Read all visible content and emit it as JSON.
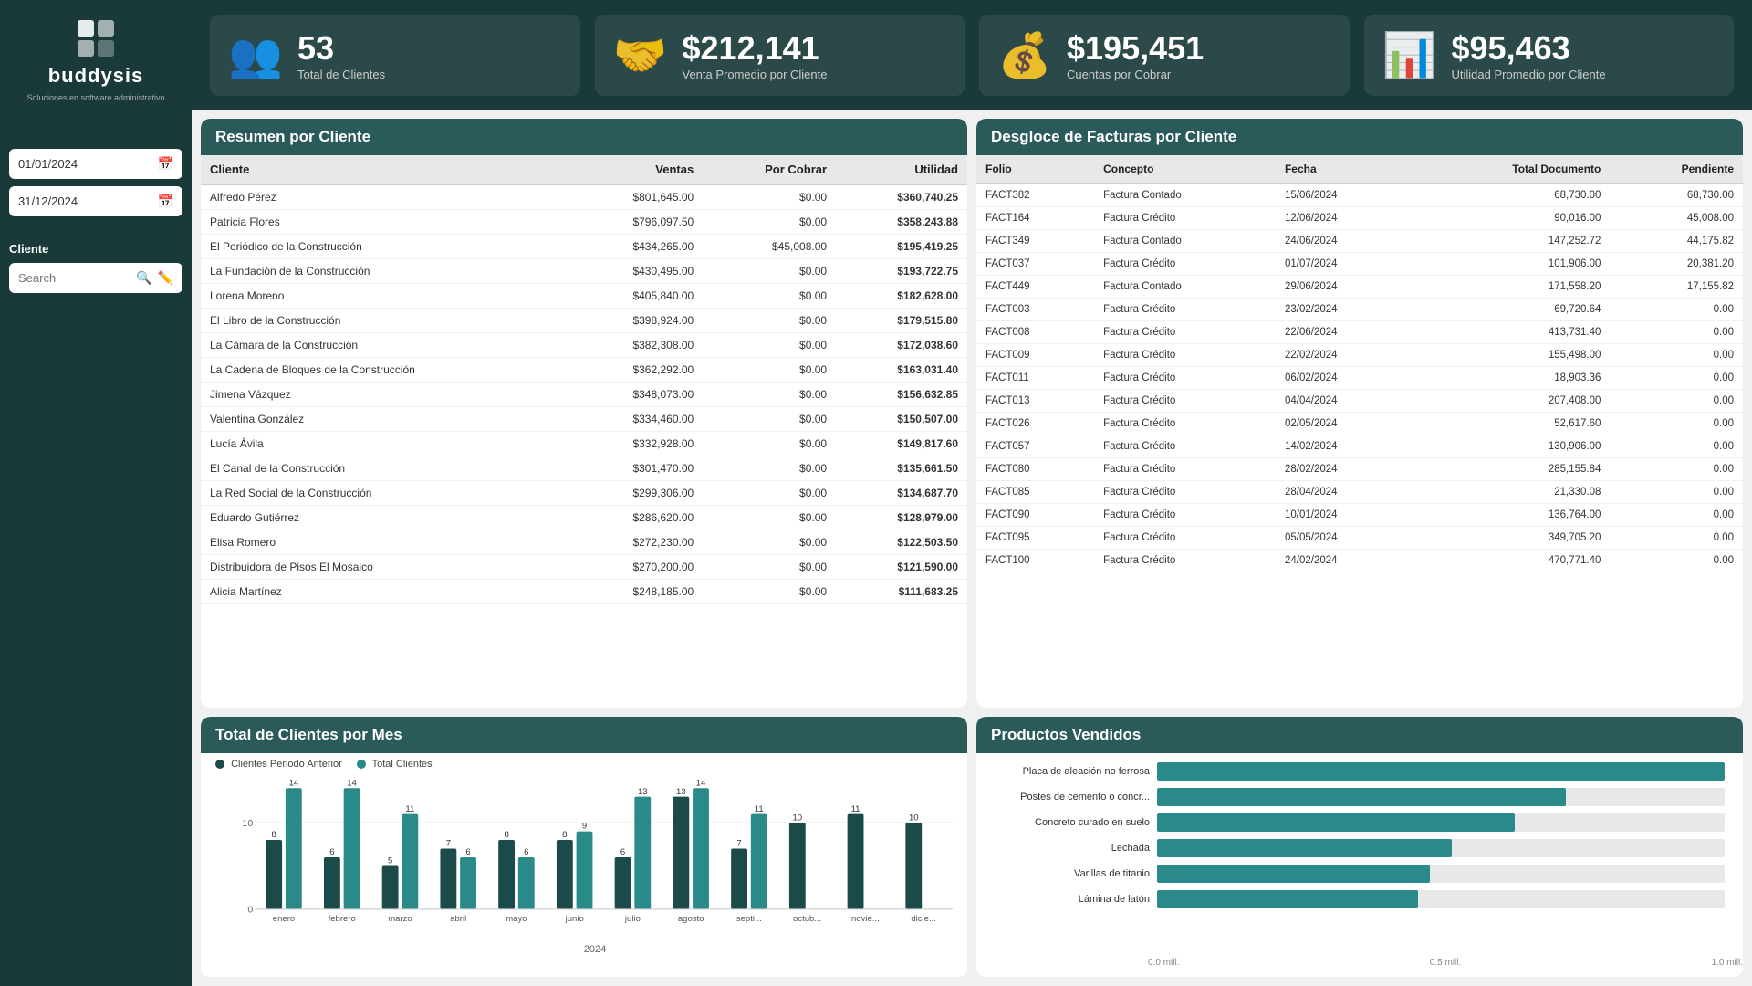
{
  "logo": {
    "text": "buddysis",
    "sub": "Soluciones en software administrativo"
  },
  "dates": {
    "start": "01/01/2024",
    "end": "31/12/2024"
  },
  "filter": {
    "label": "Cliente",
    "search_placeholder": "Search"
  },
  "stats": [
    {
      "value": "53",
      "label": "Total de Clientes",
      "icon": "👥"
    },
    {
      "value": "$212,141",
      "label": "Venta Promedio por Cliente",
      "icon": "🤝"
    },
    {
      "value": "$195,451",
      "label": "Cuentas por Cobrar",
      "icon": "💰"
    },
    {
      "value": "$95,463",
      "label": "Utilidad Promedio por Cliente",
      "icon": "📊"
    }
  ],
  "resumen": {
    "title": "Resumen por Cliente",
    "columns": [
      "Cliente",
      "Ventas",
      "Por Cobrar",
      "Utilidad"
    ],
    "rows": [
      [
        "Alfredo Pérez",
        "$801,645.00",
        "$0.00",
        "$360,740.25"
      ],
      [
        "Patricia Flores",
        "$796,097.50",
        "$0.00",
        "$358,243.88"
      ],
      [
        "El Periódico de la Construcción",
        "$434,265.00",
        "$45,008.00",
        "$195,419.25"
      ],
      [
        "La Fundación de la Construcción",
        "$430,495.00",
        "$0.00",
        "$193,722.75"
      ],
      [
        "Lorena Moreno",
        "$405,840.00",
        "$0.00",
        "$182,628.00"
      ],
      [
        "El Libro de la Construcción",
        "$398,924.00",
        "$0.00",
        "$179,515.80"
      ],
      [
        "La Cámara de la Construcción",
        "$382,308.00",
        "$0.00",
        "$172,038.60"
      ],
      [
        "La Cadena de Bloques de la Construcción",
        "$362,292.00",
        "$0.00",
        "$163,031.40"
      ],
      [
        "Jimena Vázquez",
        "$348,073.00",
        "$0.00",
        "$156,632.85"
      ],
      [
        "Valentina González",
        "$334,460.00",
        "$0.00",
        "$150,507.00"
      ],
      [
        "Lucía Ávila",
        "$332,928.00",
        "$0.00",
        "$149,817.60"
      ],
      [
        "El Canal de la Construcción",
        "$301,470.00",
        "$0.00",
        "$135,661.50"
      ],
      [
        "La Red Social de la Construcción",
        "$299,306.00",
        "$0.00",
        "$134,687.70"
      ],
      [
        "Eduardo Gutiérrez",
        "$286,620.00",
        "$0.00",
        "$128,979.00"
      ],
      [
        "Elisa Romero",
        "$272,230.00",
        "$0.00",
        "$122,503.50"
      ],
      [
        "Distribuidora de Pisos El Mosaico",
        "$270,200.00",
        "$0.00",
        "$121,590.00"
      ],
      [
        "Alicia Martínez",
        "$248,185.00",
        "$0.00",
        "$111,683.25"
      ]
    ]
  },
  "facturas": {
    "title": "Desgloce de Facturas por Cliente",
    "columns": [
      "Folio",
      "Concepto",
      "Fecha",
      "Total Documento",
      "Pendiente"
    ],
    "rows": [
      [
        "FACT382",
        "Factura Contado",
        "15/06/2024",
        "68,730.00",
        "68,730.00"
      ],
      [
        "FACT164",
        "Factura Crédito",
        "12/06/2024",
        "90,016.00",
        "45,008.00"
      ],
      [
        "FACT349",
        "Factura Contado",
        "24/06/2024",
        "147,252.72",
        "44,175.82"
      ],
      [
        "FACT037",
        "Factura Crédito",
        "01/07/2024",
        "101,906.00",
        "20,381.20"
      ],
      [
        "FACT449",
        "Factura Contado",
        "29/06/2024",
        "171,558.20",
        "17,155.82"
      ],
      [
        "FACT003",
        "Factura Crédito",
        "23/02/2024",
        "69,720.64",
        "0.00"
      ],
      [
        "FACT008",
        "Factura Crédito",
        "22/06/2024",
        "413,731.40",
        "0.00"
      ],
      [
        "FACT009",
        "Factura Crédito",
        "22/02/2024",
        "155,498.00",
        "0.00"
      ],
      [
        "FACT011",
        "Factura Crédito",
        "06/02/2024",
        "18,903.36",
        "0.00"
      ],
      [
        "FACT013",
        "Factura Crédito",
        "04/04/2024",
        "207,408.00",
        "0.00"
      ],
      [
        "FACT026",
        "Factura Crédito",
        "02/05/2024",
        "52,617.60",
        "0.00"
      ],
      [
        "FACT057",
        "Factura Crédito",
        "14/02/2024",
        "130,906.00",
        "0.00"
      ],
      [
        "FACT080",
        "Factura Crédito",
        "28/02/2024",
        "285,155.84",
        "0.00"
      ],
      [
        "FACT085",
        "Factura Crédito",
        "28/04/2024",
        "21,330.08",
        "0.00"
      ],
      [
        "FACT090",
        "Factura Crédito",
        "10/01/2024",
        "136,764.00",
        "0.00"
      ],
      [
        "FACT095",
        "Factura Crédito",
        "05/05/2024",
        "349,705.20",
        "0.00"
      ],
      [
        "FACT100",
        "Factura Crédito",
        "24/02/2024",
        "470,771.40",
        "0.00"
      ]
    ]
  },
  "clientes_mes": {
    "title": "Total de Clientes por Mes",
    "legend": [
      "Clientes Periodo Anterior",
      "Total Clientes"
    ],
    "year": "2024",
    "months": [
      "enero",
      "febrero",
      "marzo",
      "abril",
      "mayo",
      "junio",
      "julio",
      "agosto",
      "septi...",
      "octub...",
      "novie...",
      "dicie..."
    ],
    "prev": [
      8,
      6,
      5,
      7,
      8,
      8,
      6,
      13,
      7,
      10,
      11,
      10
    ],
    "total": [
      14,
      14,
      11,
      6,
      6,
      9,
      13,
      14,
      11,
      0,
      0,
      0
    ],
    "y_labels": [
      "0",
      "0",
      "10"
    ]
  },
  "productos": {
    "title": "Productos Vendidos",
    "items": [
      {
        "label": "Placa de aleación no ferrosa",
        "value": 1.0
      },
      {
        "label": "Postes de cemento o concr...",
        "value": 0.72
      },
      {
        "label": "Concreto curado en suelo",
        "value": 0.63
      },
      {
        "label": "Lechada",
        "value": 0.52
      },
      {
        "label": "Varillas de titanio",
        "value": 0.48
      },
      {
        "label": "Lámina de latón",
        "value": 0.46
      }
    ],
    "axis_labels": [
      "0.0 mill.",
      "0.5 mill.",
      "1.0 mill."
    ]
  },
  "colors": {
    "primary": "#1a3a3a",
    "accent": "#2a8a8a",
    "header": "#2a5a5a",
    "bar_dark": "#1a4a4a",
    "bar_light": "#2a8a8a"
  }
}
